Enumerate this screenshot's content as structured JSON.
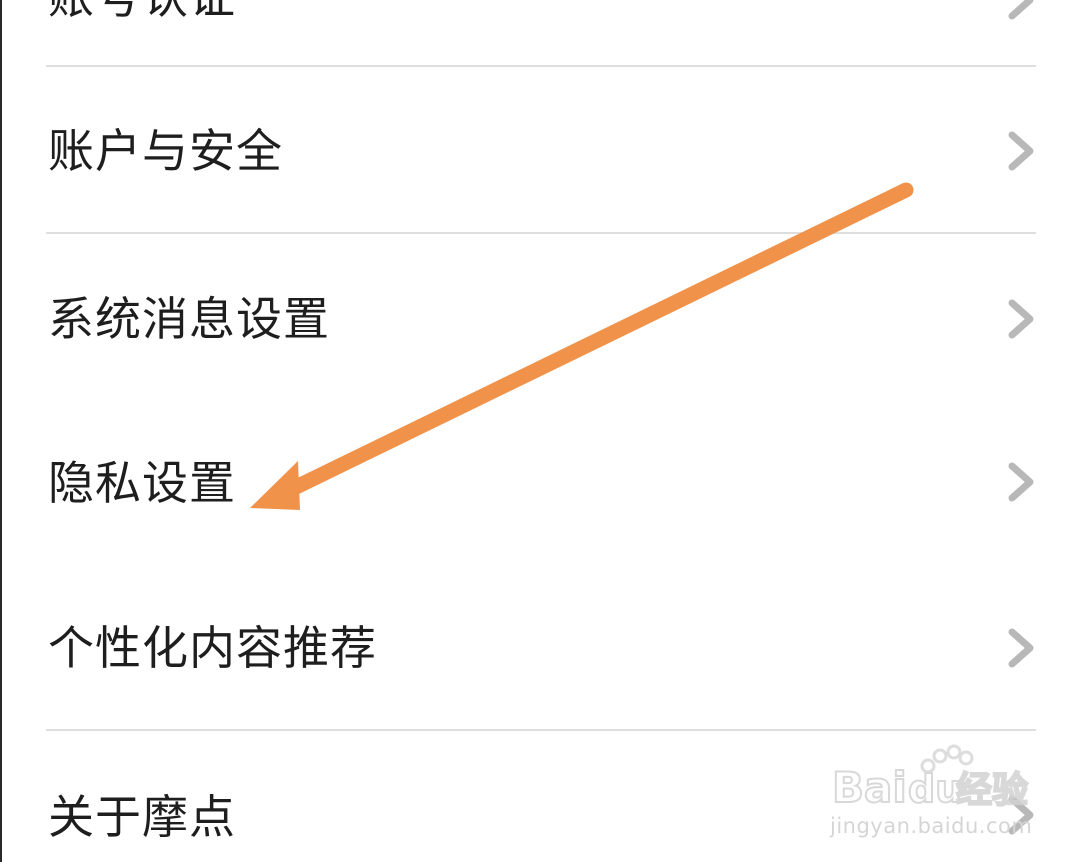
{
  "settings": {
    "items": [
      {
        "label": "账号认证",
        "partial": true
      },
      {
        "label": "账户与安全"
      },
      {
        "label": "系统消息设置"
      },
      {
        "label": "隐私设置"
      },
      {
        "label": "个性化内容推荐"
      },
      {
        "label": "关于摩点"
      }
    ]
  },
  "annotation": {
    "arrow_color": "#F0924A",
    "points_to": "隐私设置"
  },
  "watermark": {
    "brand": "Baidu经验",
    "url": "jingyan.baidu.com"
  },
  "colors": {
    "text": "#1E1E1E",
    "divider": "#DEDEDE",
    "chevron": "#B8B8B8"
  }
}
